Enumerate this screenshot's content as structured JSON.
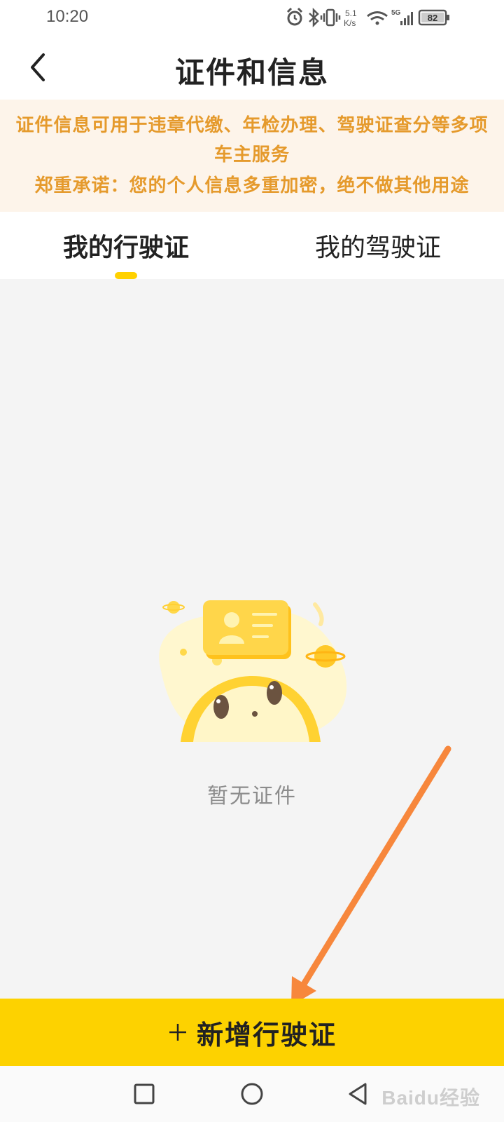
{
  "status_bar": {
    "time": "10:20",
    "net_speed_value": "5.1",
    "net_speed_unit": "K/s",
    "network_type": "5G",
    "battery": "82",
    "icons": [
      "alarm-icon",
      "bluetooth-icon",
      "vibrate-icon",
      "wifi-icon",
      "signal-icon",
      "battery-icon"
    ]
  },
  "header": {
    "title": "证件和信息",
    "back_icon": "chevron-left-icon"
  },
  "notice": {
    "line1": "证件信息可用于违章代缴、年检办理、驾驶证查分等多项车主服务",
    "line2": "郑重承诺：您的个人信息多重加密，绝不做其他用途",
    "color": "#e59a2c",
    "background": "#fdf4ea"
  },
  "tabs": [
    {
      "label": "我的行驶证",
      "active": true
    },
    {
      "label": "我的驾驶证",
      "active": false
    }
  ],
  "empty_state": {
    "text": "暂无证件",
    "illustration": "id-card-mascot-illustration"
  },
  "add_button": {
    "label": "新增行驶证",
    "icon": "plus-icon",
    "color": "#fdd200"
  },
  "annotation": {
    "icon": "orange-arrow-annotation",
    "color": "#f7873c"
  },
  "nav_bar": {
    "buttons": [
      "recents-square-icon",
      "home-circle-icon",
      "back-triangle-icon"
    ]
  },
  "watermark": "Baidu经验",
  "colors": {
    "accent": "#ffd100",
    "content_background": "#f4f4f4"
  }
}
